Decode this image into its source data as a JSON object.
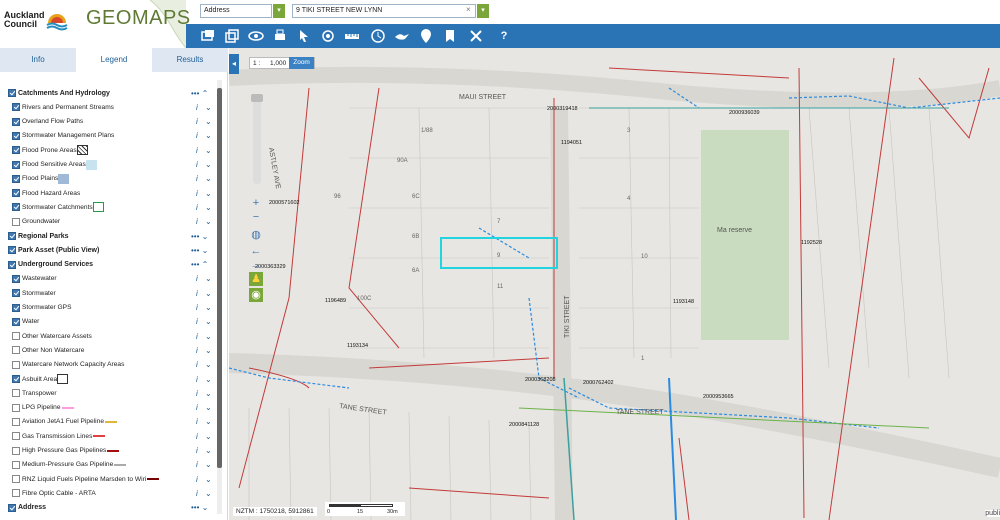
{
  "brand": {
    "council": "Auckland Council",
    "app": "GEOMAPS"
  },
  "search": {
    "type": "Address",
    "query": "9 TIKI STREET NEW LYNN"
  },
  "tabs": [
    "Info",
    "Legend",
    "Results"
  ],
  "layers": [
    {
      "label": "Catchments And Hydrology",
      "level": 0
    },
    {
      "label": "Rivers and Permanent Streams",
      "level": 1
    },
    {
      "label": "Overland Flow Paths",
      "level": 1
    },
    {
      "label": "Stormwater Management Plans",
      "level": 1
    },
    {
      "label": "Flood Prone Areas",
      "level": 1
    },
    {
      "label": "Flood Sensitive Areas",
      "level": 1
    },
    {
      "label": "Flood Plains",
      "level": 1
    },
    {
      "label": "Flood Hazard Areas",
      "level": 1
    },
    {
      "label": "Stormwater Catchments",
      "level": 1
    },
    {
      "label": "Groundwater",
      "level": 1
    },
    {
      "label": "Regional Parks",
      "level": 0
    },
    {
      "label": "Park Asset (Public View)",
      "level": 0
    },
    {
      "label": "Underground Services",
      "level": 0
    },
    {
      "label": "Wastewater",
      "level": 1
    },
    {
      "label": "Stormwater",
      "level": 1
    },
    {
      "label": "Stormwater GPS",
      "level": 1
    },
    {
      "label": "Water",
      "level": 1
    },
    {
      "label": "Other Watercare Assets",
      "level": 1
    },
    {
      "label": "Other Non Watercare",
      "level": 1
    },
    {
      "label": "Watercare Network Capacity Areas",
      "level": 1
    },
    {
      "label": "Asbuilt Area",
      "level": 1
    },
    {
      "label": "Transpower",
      "level": 1
    },
    {
      "label": "LPG Pipeline",
      "level": 1
    },
    {
      "label": "Aviation JetA1 Fuel Pipeline",
      "level": 1
    },
    {
      "label": "Gas Transmission Lines",
      "level": 1
    },
    {
      "label": "High Pressure Gas Pipelines",
      "level": 1
    },
    {
      "label": "Medium-Pressure Gas Pipeline",
      "level": 1
    },
    {
      "label": "RNZ Liquid Fuels Pipeline Marsden to Wiri",
      "level": 1
    },
    {
      "label": "Fibre Optic Cable - ARTA",
      "level": 1
    },
    {
      "label": "Address",
      "level": 0
    }
  ],
  "map": {
    "scale_prefix": "1 :",
    "scale": "1,000",
    "zoom_label": "Zoom",
    "coords": "NZTM : 1750218, 5912861",
    "scalebar": [
      "0",
      "15",
      "30m"
    ],
    "attribution": "publi",
    "streets": [
      "MAUI STREET",
      "TANE STREET",
      "TANE STREET",
      "TIKI STREET",
      "ASTLEY AVE"
    ],
    "reserve": "Ma   reserve",
    "lot_numbers": [
      "1/88",
      "7",
      "9",
      "11",
      "6B",
      "6A",
      "6C",
      "90A",
      "96",
      "10",
      "4",
      "100C",
      "3",
      "1"
    ],
    "asset_ids": [
      "2000319418",
      "2000571602",
      "2000363329",
      "2000368208",
      "2000762402",
      "2000936039",
      "1194051",
      "1192528",
      "2000953665",
      "2000841128",
      "1193148",
      "1193134",
      "1196489"
    ]
  },
  "colors": {
    "toolbar": "#2a74b6",
    "selection": "#22d3e0",
    "wastewater": "#c33a3a",
    "stormwater": "#2b8be0",
    "water": "#3aa0a0",
    "reserve": "#c9dcbf"
  }
}
